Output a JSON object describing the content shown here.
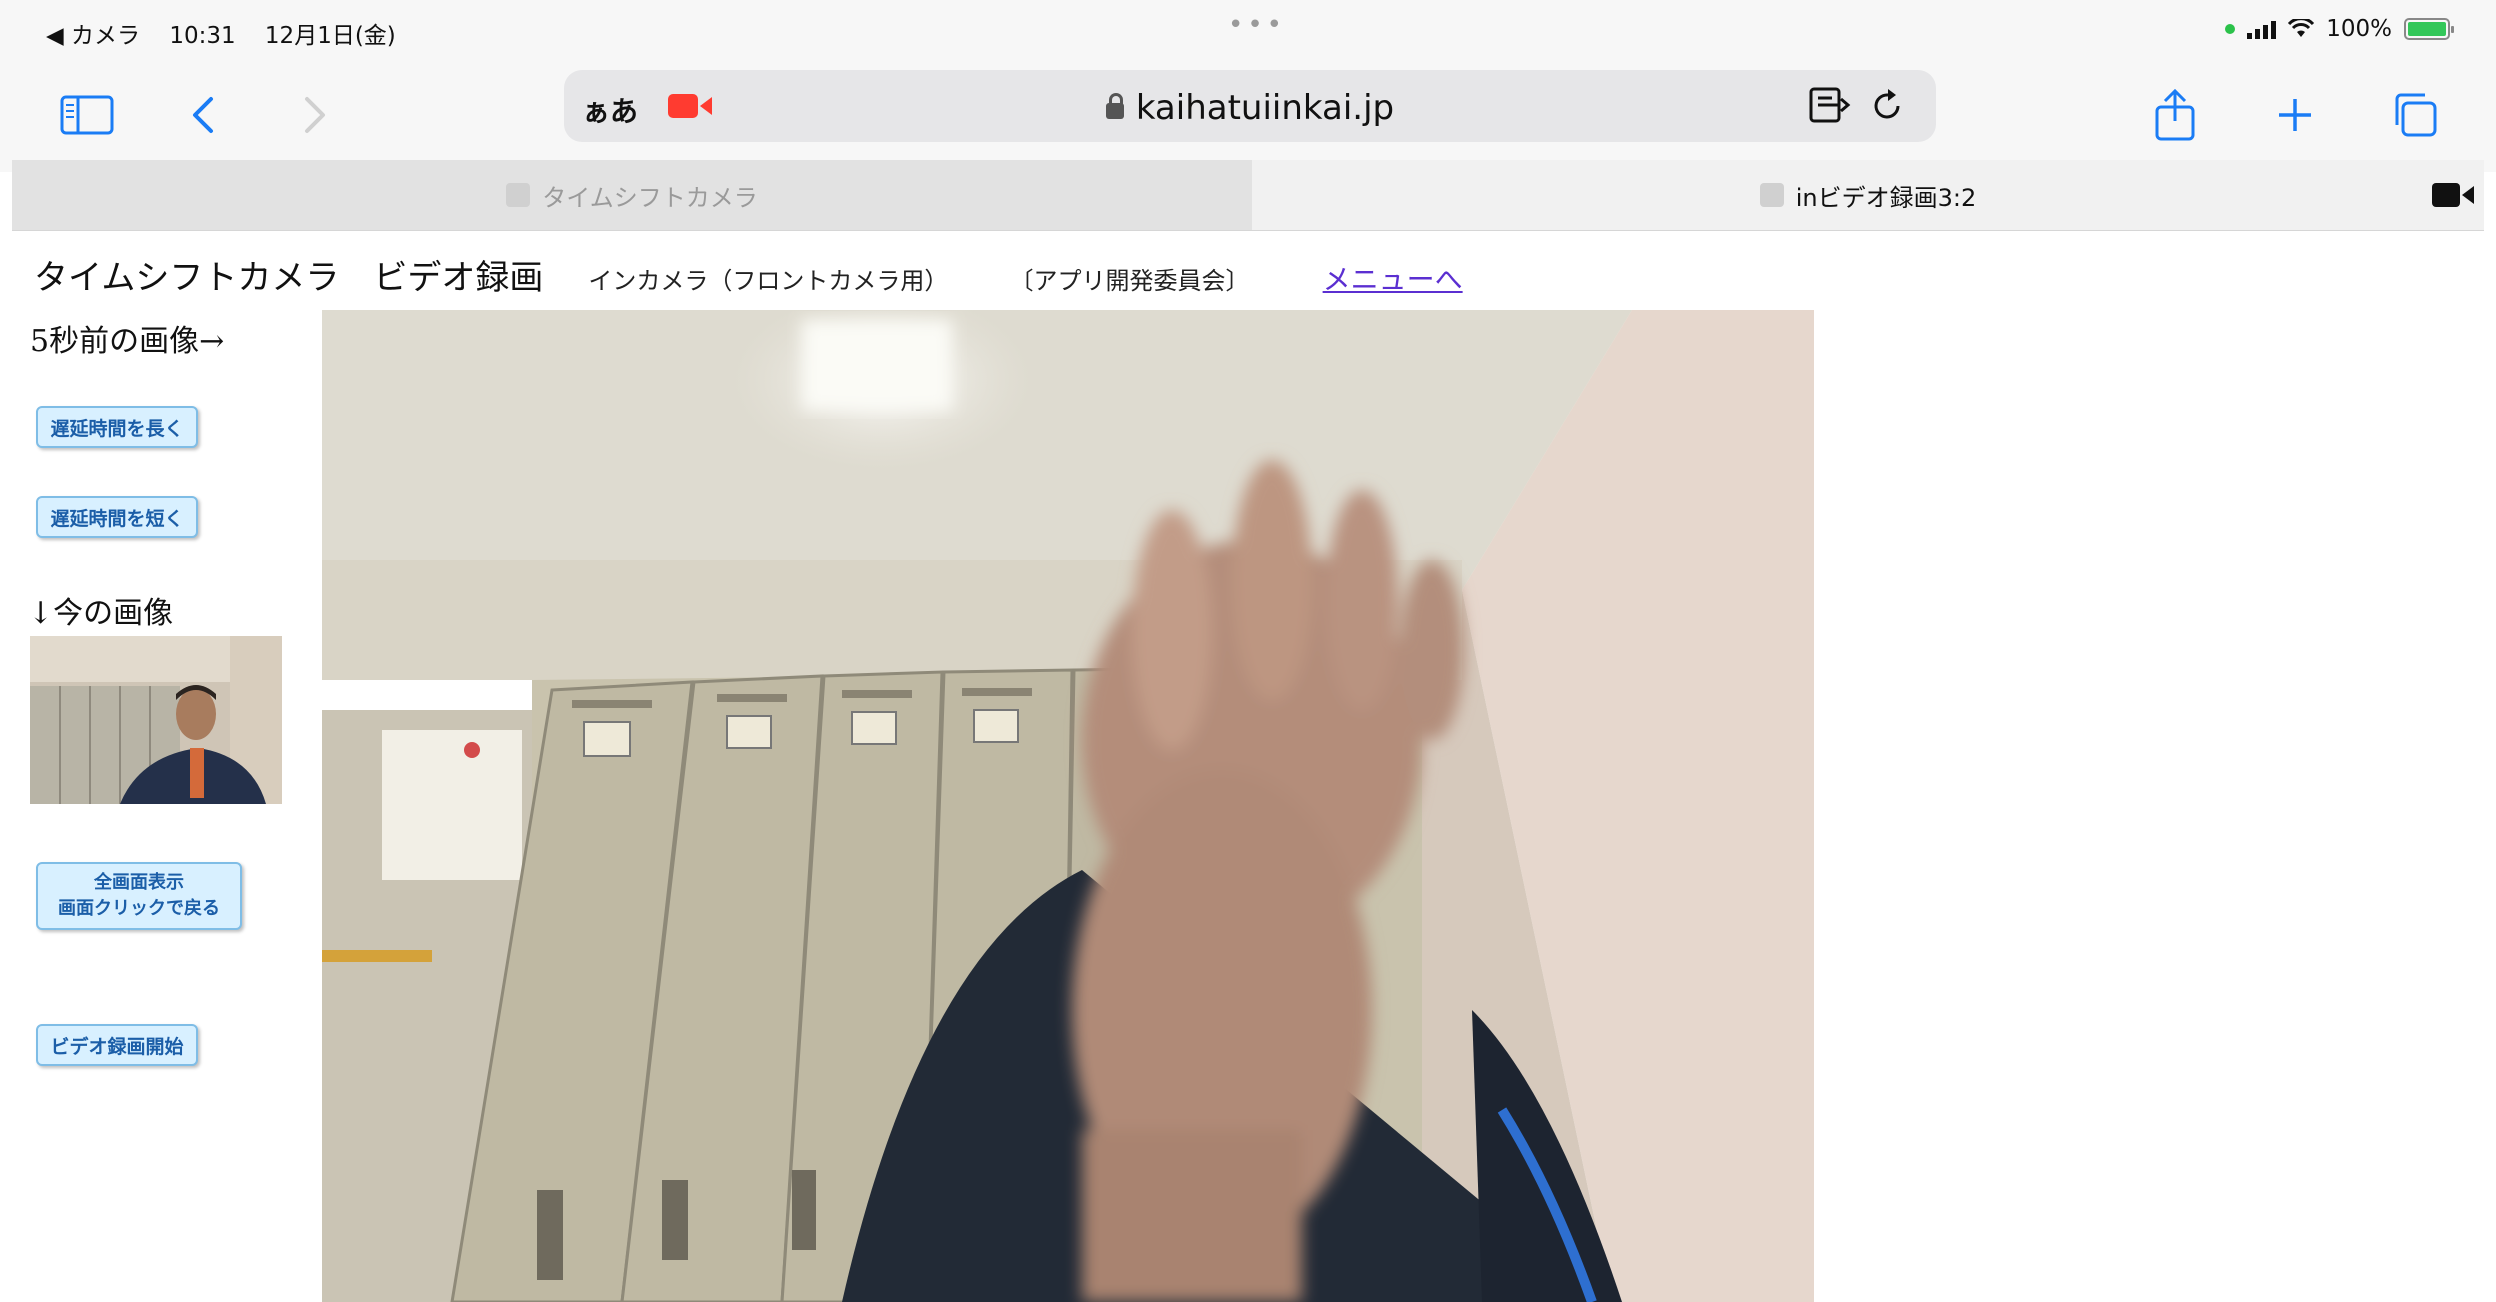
{
  "status_bar": {
    "back_app": "◀ カメラ",
    "time": "10:31",
    "date": "12月1日(金)",
    "dots": "•••",
    "battery_text": "100%"
  },
  "toolbar": {
    "text_size_label": "ぁあ",
    "url": "kaihatuiinkai.jp"
  },
  "tabs": [
    {
      "label": "タイムシフトカメラ"
    },
    {
      "label": "inビデオ録画3:2"
    }
  ],
  "page": {
    "title": "タイムシフトカメラ　ビデオ録画",
    "subtitle": "インカメラ（フロントカメラ用）",
    "org": "〔アプリ開発委員会〕",
    "menu_link": "メニューへ",
    "label_5sec": "5秒前の画像→",
    "btn_longer": "遅延時間を長く",
    "btn_shorter": "遅延時間を短く",
    "label_now": "↓今の画像",
    "btn_fullscreen_line1": "全画面表示",
    "btn_fullscreen_line2": "画面クリックで戻る",
    "btn_video_start": "ビデオ録画開始"
  },
  "colors": {
    "accent": "#1a7cf5",
    "record_red": "#ff3b30",
    "link_purple": "#5b2fd1",
    "button_bg": "#d8f0ff"
  }
}
